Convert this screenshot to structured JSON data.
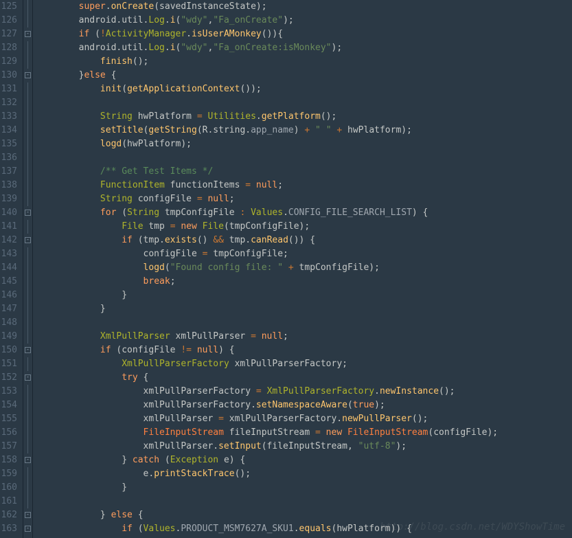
{
  "lineNumbers": [
    "125",
    "126",
    "127",
    "128",
    "129",
    "130",
    "131",
    "132",
    "133",
    "134",
    "135",
    "136",
    "137",
    "138",
    "139",
    "140",
    "141",
    "142",
    "143",
    "144",
    "145",
    "146",
    "147",
    "148",
    "149",
    "150",
    "151",
    "152",
    "153",
    "154",
    "155",
    "156",
    "157",
    "158",
    "159",
    "160",
    "161",
    "162",
    "163"
  ],
  "foldMarkers": [
    "",
    "",
    "box",
    "",
    "",
    "box",
    "",
    "",
    "",
    "",
    "",
    "",
    "",
    "",
    "",
    "box",
    "",
    "box",
    "",
    "",
    "",
    "",
    "",
    "",
    "",
    "box",
    "",
    "box",
    "",
    "",
    "",
    "",
    "",
    "box",
    "",
    "",
    "",
    "box",
    "box"
  ],
  "code": [
    [
      [
        "plain",
        "        "
      ],
      [
        "kw",
        "super"
      ],
      [
        "plain",
        "."
      ],
      [
        "method",
        "onCreate"
      ],
      [
        "plain",
        "(savedInstanceState);"
      ]
    ],
    [
      [
        "plain",
        "        android.util."
      ],
      [
        "cls",
        "Log"
      ],
      [
        "plain",
        "."
      ],
      [
        "method",
        "i"
      ],
      [
        "plain",
        "("
      ],
      [
        "str",
        "\"wdy\""
      ],
      [
        "plain",
        ","
      ],
      [
        "str",
        "\"Fa_onCreate\""
      ],
      [
        "plain",
        ");"
      ]
    ],
    [
      [
        "plain",
        "        "
      ],
      [
        "kw",
        "if"
      ],
      [
        "plain",
        " ("
      ],
      [
        "op",
        "!"
      ],
      [
        "cls",
        "ActivityManager"
      ],
      [
        "plain",
        "."
      ],
      [
        "method",
        "isUserAMonkey"
      ],
      [
        "plain",
        "()){"
      ]
    ],
    [
      [
        "plain",
        "        android.util."
      ],
      [
        "cls",
        "Log"
      ],
      [
        "plain",
        "."
      ],
      [
        "method",
        "i"
      ],
      [
        "plain",
        "("
      ],
      [
        "str",
        "\"wdy\""
      ],
      [
        "plain",
        ","
      ],
      [
        "str",
        "\"Fa_onCreate:isMonkey\""
      ],
      [
        "plain",
        ");"
      ]
    ],
    [
      [
        "plain",
        "            "
      ],
      [
        "method",
        "finish"
      ],
      [
        "plain",
        "();"
      ]
    ],
    [
      [
        "plain",
        "        }"
      ],
      [
        "kw",
        "else"
      ],
      [
        "plain",
        " {"
      ]
    ],
    [
      [
        "plain",
        "            "
      ],
      [
        "method",
        "init"
      ],
      [
        "plain",
        "("
      ],
      [
        "method",
        "getApplicationContext"
      ],
      [
        "plain",
        "());"
      ]
    ],
    [
      [
        "plain",
        ""
      ]
    ],
    [
      [
        "plain",
        "            "
      ],
      [
        "cls",
        "String"
      ],
      [
        "plain",
        " hwPlatform "
      ],
      [
        "op",
        "="
      ],
      [
        "plain",
        " "
      ],
      [
        "cls",
        "Utilities"
      ],
      [
        "plain",
        "."
      ],
      [
        "method",
        "getPlatform"
      ],
      [
        "plain",
        "();"
      ]
    ],
    [
      [
        "plain",
        "            "
      ],
      [
        "method",
        "setTitle"
      ],
      [
        "plain",
        "("
      ],
      [
        "method",
        "getString"
      ],
      [
        "plain",
        "(R.string."
      ],
      [
        "gray",
        "app_name"
      ],
      [
        "plain",
        ") "
      ],
      [
        "op",
        "+"
      ],
      [
        "plain",
        " "
      ],
      [
        "str",
        "\" \""
      ],
      [
        "plain",
        " "
      ],
      [
        "op",
        "+"
      ],
      [
        "plain",
        " hwPlatform);"
      ]
    ],
    [
      [
        "plain",
        "            "
      ],
      [
        "method",
        "logd"
      ],
      [
        "plain",
        "(hwPlatform);"
      ]
    ],
    [
      [
        "plain",
        ""
      ]
    ],
    [
      [
        "plain",
        "            "
      ],
      [
        "cmt",
        "/** Get Test Items */"
      ]
    ],
    [
      [
        "plain",
        "            "
      ],
      [
        "cls",
        "FunctionItem"
      ],
      [
        "plain",
        " functionItems "
      ],
      [
        "op",
        "="
      ],
      [
        "plain",
        " "
      ],
      [
        "kw",
        "null"
      ],
      [
        "plain",
        ";"
      ]
    ],
    [
      [
        "plain",
        "            "
      ],
      [
        "cls",
        "String"
      ],
      [
        "plain",
        " configFile "
      ],
      [
        "op",
        "="
      ],
      [
        "plain",
        " "
      ],
      [
        "kw",
        "null"
      ],
      [
        "plain",
        ";"
      ]
    ],
    [
      [
        "plain",
        "            "
      ],
      [
        "kw",
        "for"
      ],
      [
        "plain",
        " ("
      ],
      [
        "cls",
        "String"
      ],
      [
        "plain",
        " tmpConfigFile "
      ],
      [
        "op",
        ":"
      ],
      [
        "plain",
        " "
      ],
      [
        "cls",
        "Values"
      ],
      [
        "plain",
        "."
      ],
      [
        "gray",
        "CONFIG_FILE_SEARCH_LIST"
      ],
      [
        "plain",
        ") {"
      ]
    ],
    [
      [
        "plain",
        "                "
      ],
      [
        "cls",
        "File"
      ],
      [
        "plain",
        " tmp "
      ],
      [
        "op",
        "="
      ],
      [
        "plain",
        " "
      ],
      [
        "kw",
        "new"
      ],
      [
        "plain",
        " "
      ],
      [
        "cls",
        "File"
      ],
      [
        "plain",
        "(tmpConfigFile);"
      ]
    ],
    [
      [
        "plain",
        "                "
      ],
      [
        "kw",
        "if"
      ],
      [
        "plain",
        " (tmp."
      ],
      [
        "method",
        "exists"
      ],
      [
        "plain",
        "() "
      ],
      [
        "op",
        "&&"
      ],
      [
        "plain",
        " tmp."
      ],
      [
        "method",
        "canRead"
      ],
      [
        "plain",
        "()) {"
      ]
    ],
    [
      [
        "plain",
        "                    configFile "
      ],
      [
        "op",
        "="
      ],
      [
        "plain",
        " tmpConfigFile;"
      ]
    ],
    [
      [
        "plain",
        "                    "
      ],
      [
        "method",
        "logd"
      ],
      [
        "plain",
        "("
      ],
      [
        "str",
        "\"Found config file: \""
      ],
      [
        "plain",
        " "
      ],
      [
        "op",
        "+"
      ],
      [
        "plain",
        " tmpConfigFile);"
      ]
    ],
    [
      [
        "plain",
        "                    "
      ],
      [
        "kw",
        "break"
      ],
      [
        "plain",
        ";"
      ]
    ],
    [
      [
        "plain",
        "                }"
      ]
    ],
    [
      [
        "plain",
        "            }"
      ]
    ],
    [
      [
        "plain",
        ""
      ]
    ],
    [
      [
        "plain",
        "            "
      ],
      [
        "cls",
        "XmlPullParser"
      ],
      [
        "plain",
        " xmlPullParser "
      ],
      [
        "op",
        "="
      ],
      [
        "plain",
        " "
      ],
      [
        "kw",
        "null"
      ],
      [
        "plain",
        ";"
      ]
    ],
    [
      [
        "plain",
        "            "
      ],
      [
        "kw",
        "if"
      ],
      [
        "plain",
        " (configFile "
      ],
      [
        "op",
        "!="
      ],
      [
        "plain",
        " "
      ],
      [
        "kw",
        "null"
      ],
      [
        "plain",
        ") {"
      ]
    ],
    [
      [
        "plain",
        "                "
      ],
      [
        "cls",
        "XmlPullParserFactory"
      ],
      [
        "plain",
        " xmlPullParserFactory;"
      ]
    ],
    [
      [
        "plain",
        "                "
      ],
      [
        "kw",
        "try"
      ],
      [
        "plain",
        " {"
      ]
    ],
    [
      [
        "plain",
        "                    xmlPullParserFactory "
      ],
      [
        "op",
        "="
      ],
      [
        "plain",
        " "
      ],
      [
        "cls",
        "XmlPullParserFactory"
      ],
      [
        "plain",
        "."
      ],
      [
        "method",
        "newInstance"
      ],
      [
        "plain",
        "();"
      ]
    ],
    [
      [
        "plain",
        "                    xmlPullParserFactory."
      ],
      [
        "method",
        "setNamespaceAware"
      ],
      [
        "plain",
        "("
      ],
      [
        "kw",
        "true"
      ],
      [
        "plain",
        ");"
      ]
    ],
    [
      [
        "plain",
        "                    xmlPullParser "
      ],
      [
        "op",
        "="
      ],
      [
        "plain",
        " xmlPullParserFactory."
      ],
      [
        "method",
        "newPullParser"
      ],
      [
        "plain",
        "();"
      ]
    ],
    [
      [
        "plain",
        "                    "
      ],
      [
        "kw2",
        "FileInputStream"
      ],
      [
        "plain",
        " fileInputStream "
      ],
      [
        "op",
        "="
      ],
      [
        "plain",
        " "
      ],
      [
        "kw",
        "new"
      ],
      [
        "plain",
        " "
      ],
      [
        "kw2",
        "FileInputStream"
      ],
      [
        "plain",
        "(configFile);"
      ]
    ],
    [
      [
        "plain",
        "                    xmlPullParser."
      ],
      [
        "method",
        "setInput"
      ],
      [
        "plain",
        "(fileInputStream, "
      ],
      [
        "str",
        "\"utf-8\""
      ],
      [
        "plain",
        ");"
      ]
    ],
    [
      [
        "plain",
        "                } "
      ],
      [
        "kw",
        "catch"
      ],
      [
        "plain",
        " ("
      ],
      [
        "cls",
        "Exception"
      ],
      [
        "plain",
        " e) {"
      ]
    ],
    [
      [
        "plain",
        "                    e."
      ],
      [
        "method",
        "printStackTrace"
      ],
      [
        "plain",
        "();"
      ]
    ],
    [
      [
        "plain",
        "                }"
      ]
    ],
    [
      [
        "plain",
        ""
      ]
    ],
    [
      [
        "plain",
        "            } "
      ],
      [
        "kw",
        "else"
      ],
      [
        "plain",
        " {"
      ]
    ],
    [
      [
        "plain",
        "                "
      ],
      [
        "kw",
        "if"
      ],
      [
        "plain",
        " ("
      ],
      [
        "cls",
        "Values"
      ],
      [
        "plain",
        "."
      ],
      [
        "gray",
        "PRODUCT_MSM7627A_SKU1"
      ],
      [
        "plain",
        "."
      ],
      [
        "method",
        "equals"
      ],
      [
        "plain",
        "(hwPlatform)) {"
      ]
    ]
  ],
  "watermark": "http://blog.csdn.net/WDYShowTime"
}
